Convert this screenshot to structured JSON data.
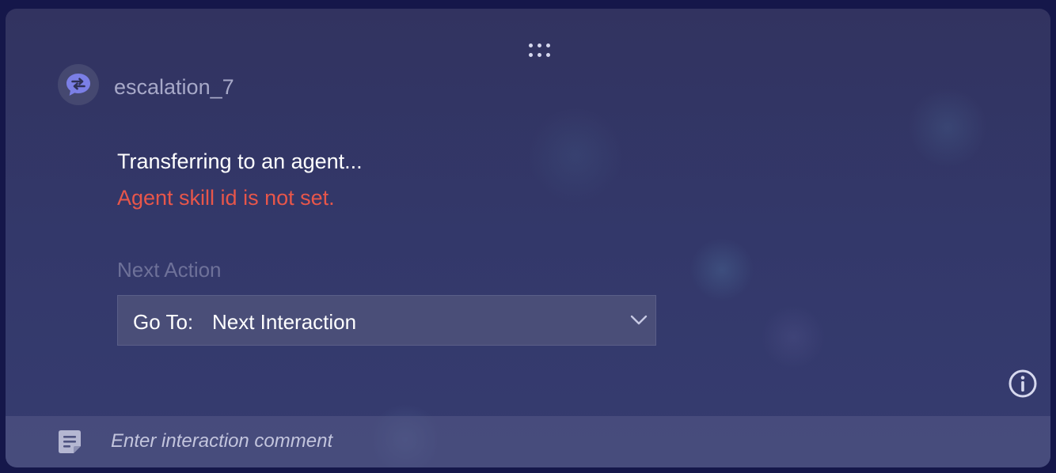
{
  "node": {
    "name": "escalation_7",
    "icon": "chat-transfer-icon"
  },
  "body": {
    "message": "Transferring to an agent...",
    "error": "Agent skill id is not set."
  },
  "next_action": {
    "label": "Next Action",
    "prefix": "Go To:",
    "selected": "Next Interaction"
  },
  "footer": {
    "comment_placeholder": "Enter interaction comment",
    "comment_value": ""
  },
  "colors": {
    "error": "#e8564a",
    "icon_accent": "#7b7fe6",
    "card_background": "#33386a"
  }
}
